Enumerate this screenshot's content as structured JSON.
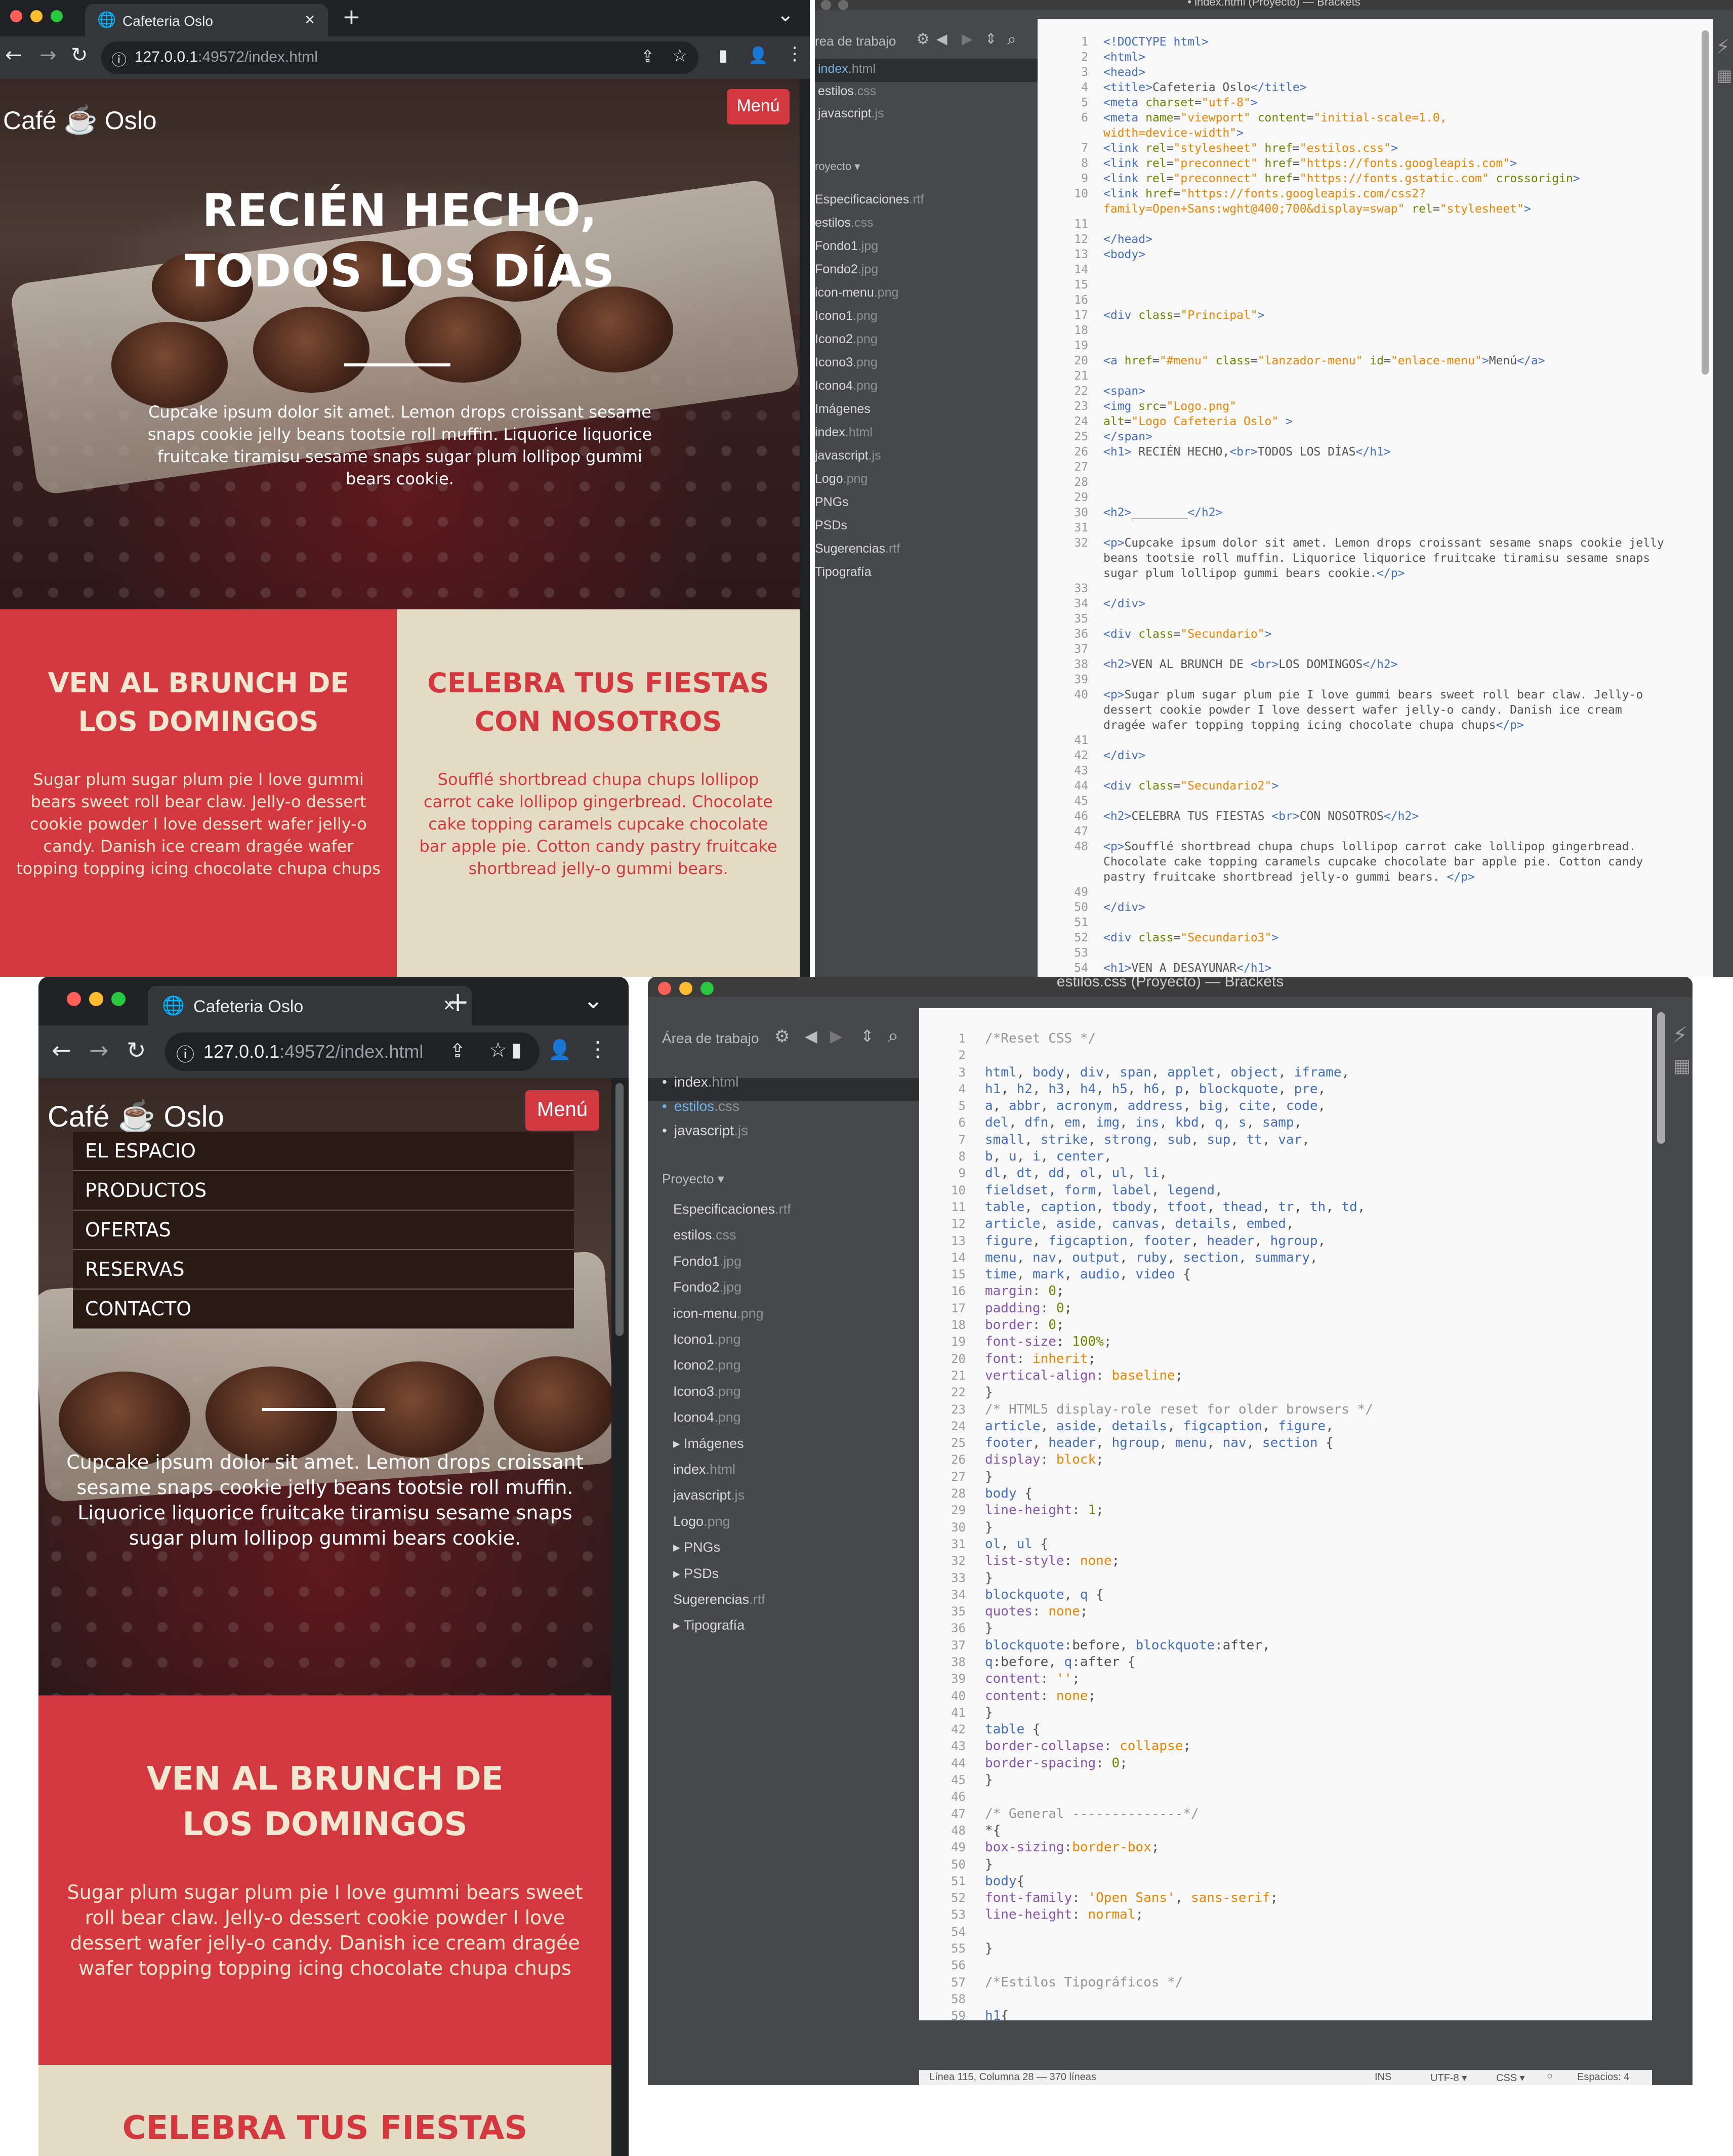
{
  "top_browser": {
    "tab_title": "Cafeteria Oslo",
    "url_host": "127.0.0.1",
    "url_path": ":49572/index.html",
    "icons": {
      "close": "×",
      "new_tab": "+",
      "dropdown": "⌄",
      "back": "←",
      "forward": "→",
      "reload": "↻",
      "share": "⇪",
      "star": "☆",
      "sidebar": "▮",
      "profile": "👤",
      "more": "⋮"
    }
  },
  "bottom_browser": {
    "tab_title": "Cafeteria Oslo",
    "url_host": "127.0.0.1",
    "url_path": ":49572/index.html"
  },
  "site": {
    "logo_left": "Café",
    "logo_right": "Oslo",
    "menu_button": "Menú",
    "hero_title_line1": "RECIÉN HECHO,",
    "hero_title_line2": "TODOS LOS DÍAS",
    "hero_text": "Cupcake ipsum dolor sit amet. Lemon drops croissant sesame snaps cookie jelly beans tootsie roll muffin. Liquorice liquorice fruitcake tiramisu sesame snaps sugar plum lollipop gummi bears cookie.",
    "brunch_title_line1": "VEN AL BRUNCH DE",
    "brunch_title_line2": "LOS DOMINGOS",
    "brunch_text": "Sugar plum sugar plum pie I love gummi bears sweet roll bear claw. Jelly-o dessert cookie powder I love dessert wafer jelly-o candy. Danish ice cream dragée wafer topping topping icing chocolate chupa chups",
    "fiesta_title_line1": "CELEBRA TUS FIESTAS",
    "fiesta_title_line2": "CON NOSOTROS",
    "fiesta_text": "Soufflé shortbread chupa chups lollipop carrot cake lollipop gingerbread. Chocolate cake topping caramels cupcake chocolate bar apple pie. Cotton candy pastry fruitcake shortbread jelly-o gummi bears.",
    "dropdown": [
      "EL ESPACIO",
      "PRODUCTOS",
      "OFERTAS",
      "RESERVAS",
      "CONTACTO"
    ],
    "brand_colors": {
      "red": "#d3383f",
      "beige": "#e4dbc5"
    }
  },
  "top_brackets": {
    "title": "• index.html (Proyecto) — Brackets",
    "workspace": "rea de trabajo",
    "working_files": [
      {
        "name": "index",
        "ext": ".html"
      },
      {
        "name": "estilos",
        "ext": ".css"
      },
      {
        "name": "javascript",
        "ext": ".js"
      }
    ],
    "project": "royecto ▾",
    "project_files": [
      {
        "name": "Especificaciones",
        "ext": ".rtf"
      },
      {
        "name": "estilos",
        "ext": ".css"
      },
      {
        "name": "Fondo1",
        "ext": ".jpg"
      },
      {
        "name": "Fondo2",
        "ext": ".jpg"
      },
      {
        "name": "icon-menu",
        "ext": ".png"
      },
      {
        "name": "Icono1",
        "ext": ".png"
      },
      {
        "name": "Icono2",
        "ext": ".png"
      },
      {
        "name": "Icono3",
        "ext": ".png"
      },
      {
        "name": "Icono4",
        "ext": ".png"
      },
      {
        "name": "Imágenes",
        "ext": ""
      },
      {
        "name": "index",
        "ext": ".html"
      },
      {
        "name": "javascript",
        "ext": ".js"
      },
      {
        "name": "Logo",
        "ext": ".png"
      },
      {
        "name": "PNGs",
        "ext": ""
      },
      {
        "name": "PSDs",
        "ext": ""
      },
      {
        "name": "Sugerencias",
        "ext": ".rtf"
      },
      {
        "name": "Tipografía",
        "ext": ""
      }
    ]
  },
  "bottom_brackets": {
    "title": "estilos.css (Proyecto) — Brackets",
    "workspace": "Área de trabajo",
    "working_files": [
      {
        "name": "index",
        "ext": ".html"
      },
      {
        "name": "estilos",
        "ext": ".css"
      },
      {
        "name": "javascript",
        "ext": ".js"
      }
    ],
    "project": "Proyecto ▾",
    "project_files": [
      {
        "name": "Especificaciones",
        "ext": ".rtf"
      },
      {
        "name": "estilos",
        "ext": ".css"
      },
      {
        "name": "Fondo1",
        "ext": ".jpg"
      },
      {
        "name": "Fondo2",
        "ext": ".jpg"
      },
      {
        "name": "icon-menu",
        "ext": ".png"
      },
      {
        "name": "Icono1",
        "ext": ".png"
      },
      {
        "name": "Icono2",
        "ext": ".png"
      },
      {
        "name": "Icono3",
        "ext": ".png"
      },
      {
        "name": "Icono4",
        "ext": ".png"
      },
      {
        "name": "▸ Imágenes",
        "ext": ""
      },
      {
        "name": "index",
        "ext": ".html"
      },
      {
        "name": "javascript",
        "ext": ".js"
      },
      {
        "name": "Logo",
        "ext": ".png"
      },
      {
        "name": "▸ PNGs",
        "ext": ""
      },
      {
        "name": "▸ PSDs",
        "ext": ""
      },
      {
        "name": "Sugerencias",
        "ext": ".rtf"
      },
      {
        "name": "▸ Tipografía",
        "ext": ""
      }
    ],
    "status": {
      "position": "Línea 115, Columna 28 — 370 líneas",
      "ins": "INS",
      "encoding": "UTF-8 ▾",
      "lang": "CSS ▾",
      "spaces": "Espacios: 4"
    }
  }
}
